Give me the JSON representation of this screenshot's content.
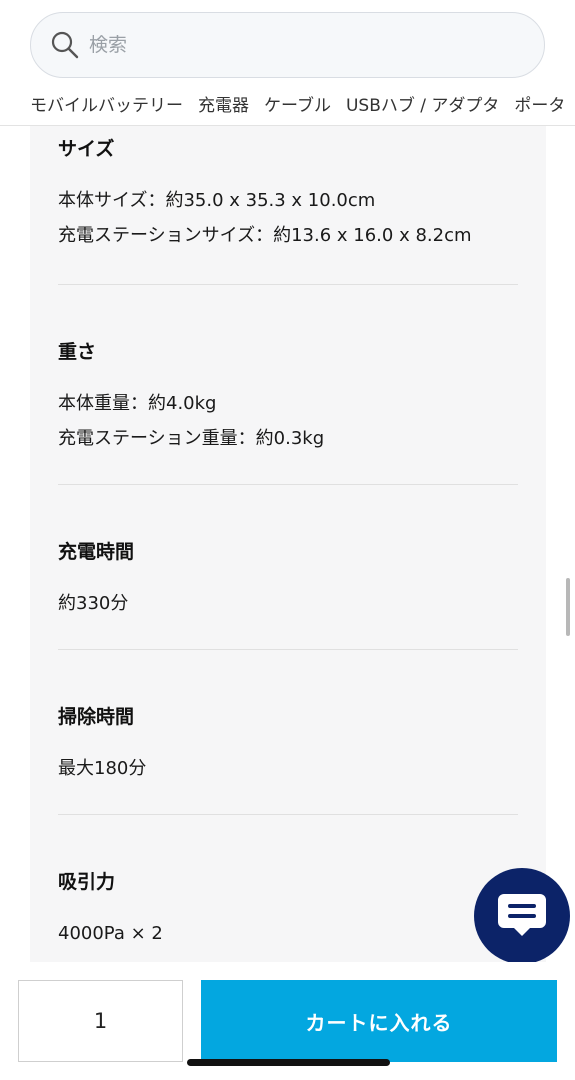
{
  "search": {
    "placeholder": "検索",
    "icon": "search-icon"
  },
  "categories": [
    "モバイルバッテリー",
    "充電器",
    "ケーブル",
    "USBハブ / アダプタ",
    "ポータ"
  ],
  "specs": [
    {
      "title": "サイズ",
      "lines": [
        "本体サイズ：約35.0 x 35.3 x 10.0cm",
        "充電ステーションサイズ：約13.6 x 16.0 x 8.2cm"
      ]
    },
    {
      "title": "重さ",
      "lines": [
        "本体重量：約4.0kg",
        "充電ステーション重量：約0.3kg"
      ]
    },
    {
      "title": "充電時間",
      "lines": [
        "約330分"
      ]
    },
    {
      "title": "掃除時間",
      "lines": [
        "最大180分"
      ]
    },
    {
      "title": "吸引力",
      "lines": [
        "4000Pa × 2"
      ]
    }
  ],
  "cart": {
    "quantity": "1",
    "add_label": "カートに入れる"
  },
  "colors": {
    "accent": "#03a7e0",
    "chat": "#0c2368",
    "panel": "#f6f6f7"
  }
}
